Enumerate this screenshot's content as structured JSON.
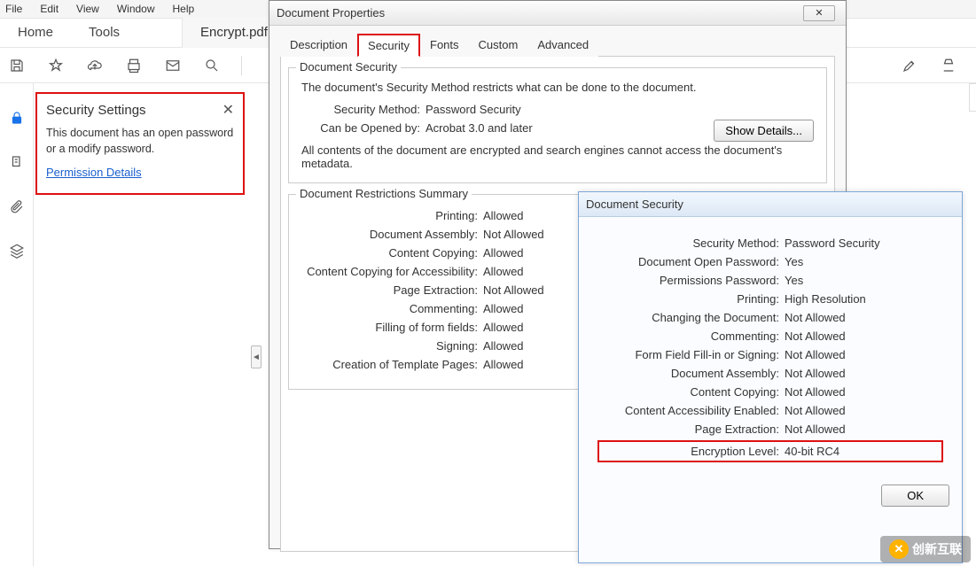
{
  "menu": {
    "file": "File",
    "edit": "Edit",
    "view": "View",
    "window": "Window",
    "help": "Help"
  },
  "tabs": {
    "home": "Home",
    "tools": "Tools",
    "filename": "Encrypt.pdf (SECUR..."
  },
  "sec_panel": {
    "title": "Security Settings",
    "body": "This document has an open password or a modify password.",
    "link": "Permission Details"
  },
  "dlg_props": {
    "title": "Document Properties",
    "tabs": {
      "description": "Description",
      "security": "Security",
      "fonts": "Fonts",
      "custom": "Custom",
      "advanced": "Advanced"
    },
    "doc_sec_legend": "Document Security",
    "intro": "The document's Security Method restricts what can be done to the document.",
    "sm_label": "Security Method:",
    "sm_value": "Password Security",
    "show_details": "Show Details...",
    "open_label": "Can be Opened by:",
    "open_value": "Acrobat 3.0 and later",
    "note": "All contents of the document are encrypted and search engines cannot access the document's metadata.",
    "restrict_legend": "Document Restrictions Summary",
    "restrictions": [
      {
        "label": "Printing:",
        "value": "Allowed"
      },
      {
        "label": "Document Assembly:",
        "value": "Not Allowed"
      },
      {
        "label": "Content Copying:",
        "value": "Allowed"
      },
      {
        "label": "Content Copying for Accessibility:",
        "value": "Allowed"
      },
      {
        "label": "Page Extraction:",
        "value": "Not Allowed"
      },
      {
        "label": "Commenting:",
        "value": "Allowed"
      },
      {
        "label": "Filling of form fields:",
        "value": "Allowed"
      },
      {
        "label": "Signing:",
        "value": "Allowed"
      },
      {
        "label": "Creation of Template Pages:",
        "value": "Allowed"
      }
    ]
  },
  "dlg_sec": {
    "title": "Document Security",
    "rows": [
      {
        "label": "Security Method:",
        "value": "Password Security"
      },
      {
        "label": "Document Open Password:",
        "value": "Yes"
      },
      {
        "label": "Permissions Password:",
        "value": "Yes"
      },
      {
        "label": "Printing:",
        "value": "High Resolution"
      },
      {
        "label": "Changing the Document:",
        "value": "Not Allowed"
      },
      {
        "label": "Commenting:",
        "value": "Not Allowed"
      },
      {
        "label": "Form Field Fill-in or Signing:",
        "value": "Not Allowed"
      },
      {
        "label": "Document Assembly:",
        "value": "Not Allowed"
      },
      {
        "label": "Content Copying:",
        "value": "Not Allowed"
      },
      {
        "label": "Content Accessibility Enabled:",
        "value": "Not Allowed"
      },
      {
        "label": "Page Extraction:",
        "value": "Not Allowed"
      },
      {
        "label": "Encryption Level:",
        "value": "40-bit RC4"
      }
    ],
    "ok": "OK"
  },
  "wm": "创新互联"
}
